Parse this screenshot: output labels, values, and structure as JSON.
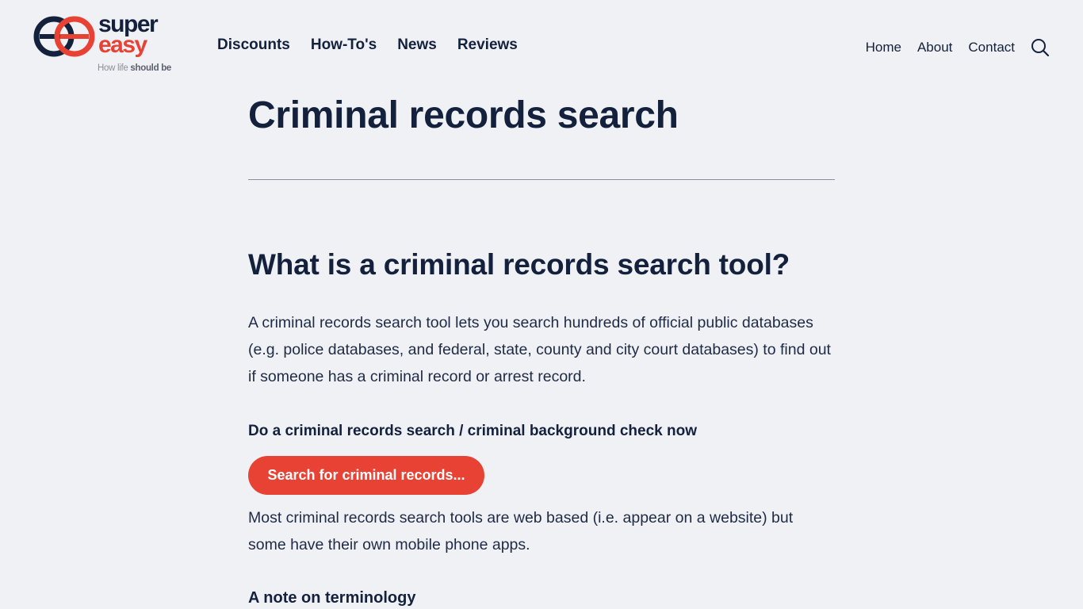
{
  "header": {
    "logo": {
      "word1": "super",
      "word2": "easy",
      "tagline_prefix": "How life ",
      "tagline_bold": "should be",
      "colors": {
        "navy": "#14213d",
        "red": "#e84234"
      }
    },
    "main_nav": [
      {
        "label": "Discounts"
      },
      {
        "label": "How-To's"
      },
      {
        "label": "News"
      },
      {
        "label": "Reviews"
      }
    ],
    "util_nav": [
      {
        "label": "Home"
      },
      {
        "label": "About"
      },
      {
        "label": "Contact"
      }
    ],
    "search_icon": "search-icon"
  },
  "article": {
    "title": "Criminal records search",
    "section_heading": "What is a criminal records search tool?",
    "intro": "A criminal records search tool lets you search hundreds of official public databases (e.g. police databases, and federal, state, county and city court databases) to find out if someone has a criminal record or arrest record.",
    "cta_label": "Do a criminal records search / criminal background check now",
    "cta_button": "Search for criminal records...",
    "cta_color": "#e84234",
    "paragraph2": "Most criminal records search tools are web based (i.e. appear on a website) but some have their own mobile phone apps.",
    "subheading": "A note on terminology"
  }
}
